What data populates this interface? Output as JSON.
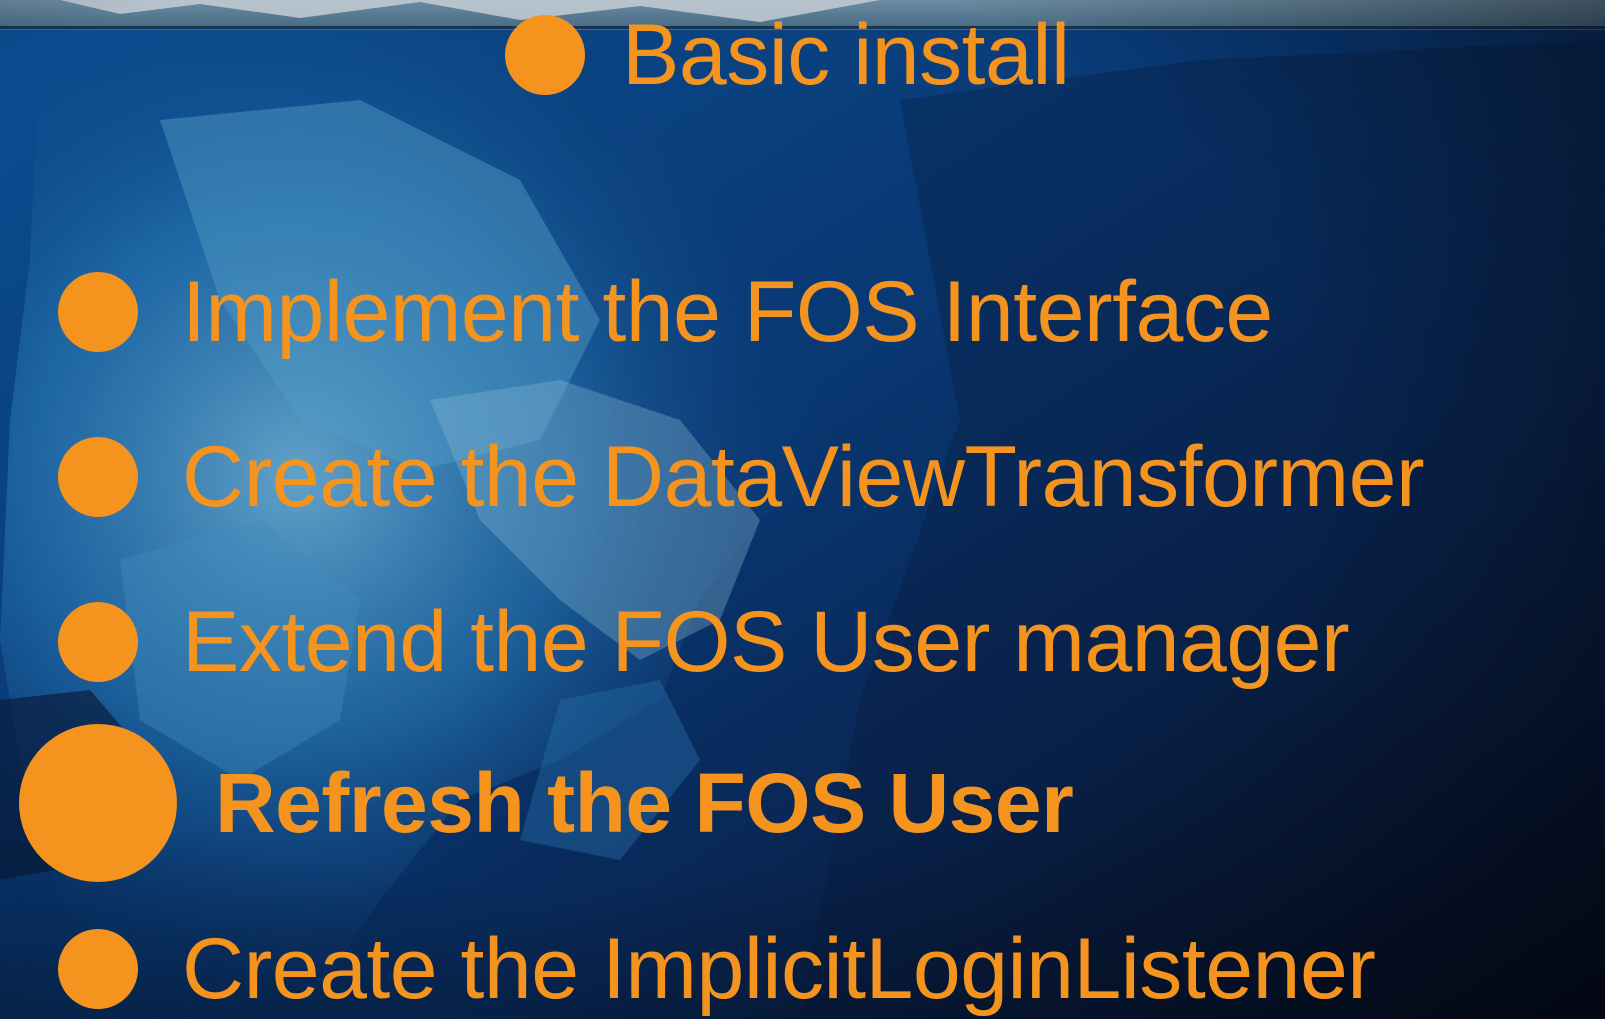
{
  "colors": {
    "accent": "#f5931f",
    "sea_dark": "#0b1c3c",
    "sea_mid": "#0f4a90",
    "ice": "#4fa6d8"
  },
  "background": {
    "image": "iceberg-underwater"
  },
  "bullets": [
    {
      "label": "Basic install",
      "highlighted": false
    },
    {
      "label": "Implement the FOS Interface",
      "highlighted": false
    },
    {
      "label": "Create the DataViewTransformer",
      "highlighted": false
    },
    {
      "label": "Extend the FOS User manager",
      "highlighted": false
    },
    {
      "label": "Refresh the FOS User",
      "highlighted": true
    },
    {
      "label": "Create the ImplicitLoginListener",
      "highlighted": false
    }
  ]
}
